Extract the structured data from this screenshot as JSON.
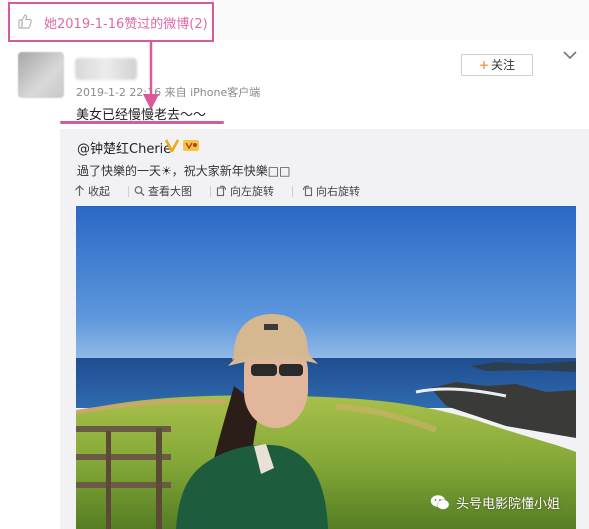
{
  "liked_header": {
    "text": "她2019-1-16赞过的微博(2)",
    "icon": "thumbs-up-icon"
  },
  "post": {
    "meta": "2019-1-2 22:16 来自 iPhone客户端",
    "text": "美女已经慢慢老去～～",
    "follow_label": "关注",
    "follow_plus": "+"
  },
  "original": {
    "author": "@钟楚红Cherie",
    "text": "過了快樂的一天☀，祝大家新年快樂□□",
    "actions": {
      "collapse": "收起",
      "view_large": "查看大图",
      "rotate_left": "向左旋转",
      "rotate_right": "向右旋转"
    }
  },
  "watermark": {
    "text": "头号电影院懂小姐",
    "icon": "wechat-icon"
  },
  "colors": {
    "annotation": "#d85a9a",
    "follow_plus": "#f29a4b",
    "repost_bg": "#f2f2f5"
  }
}
